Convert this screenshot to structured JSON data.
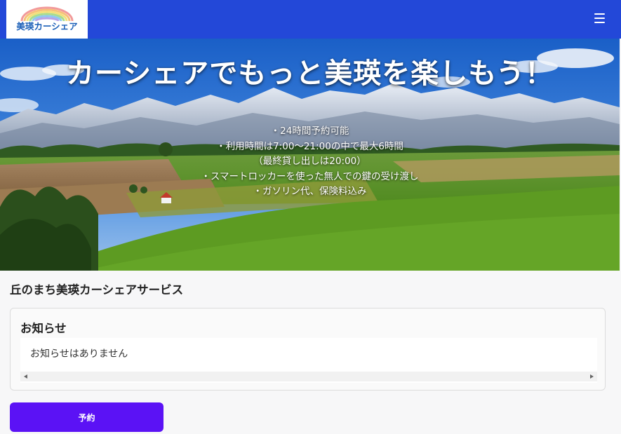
{
  "header": {
    "logo_text": "美瑛カーシェア",
    "menu_icon": "hamburger-menu-icon",
    "background_color": "#2348d8"
  },
  "hero": {
    "title": "カーシェアでもっと美瑛を楽しもう！",
    "features": [
      "・24時間予約可能",
      "・利用時間は7:00～21:00の中で最大6時間",
      "（最終貸し出しは20:00）",
      "・スマートロッカーを使った無人での鍵の受け渡し",
      "・ガソリン代、保険料込み"
    ]
  },
  "main": {
    "service_title": "丘のまち美瑛カーシェアサービス",
    "notice": {
      "title": "お知らせ",
      "message": "お知らせはありません"
    },
    "reserve_button": {
      "label": "予約",
      "color": "#5b12f5"
    }
  }
}
